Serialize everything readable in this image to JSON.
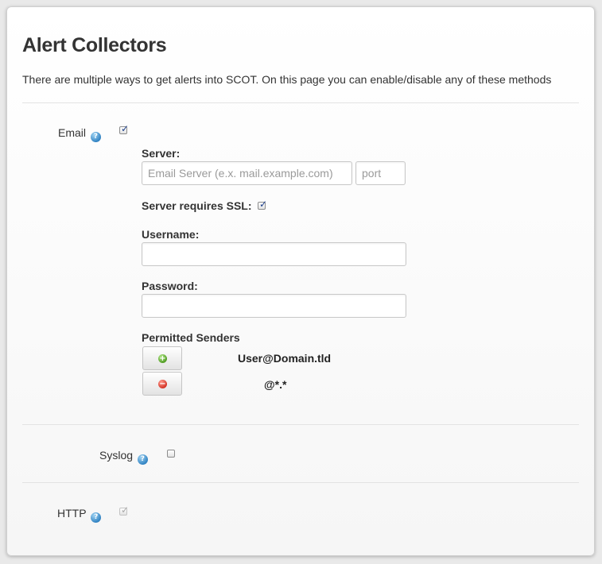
{
  "page": {
    "title": "Alert Collectors",
    "description": "There are multiple ways to get alerts into SCOT. On this page you can enable/disable any of these methods"
  },
  "email": {
    "label": "Email",
    "enabled": true,
    "server_label": "Server:",
    "server_placeholder": "Email Server (e.x. mail.example.com)",
    "server_value": "",
    "port_placeholder": "port",
    "port_value": "",
    "ssl_label": "Server requires SSL:",
    "ssl_enabled": true,
    "username_label": "Username:",
    "username_value": "",
    "password_label": "Password:",
    "password_value": "",
    "permitted_senders_label": "Permitted Senders",
    "senders": [
      "User@Domain.tld",
      "@*.*"
    ]
  },
  "syslog": {
    "label": "Syslog",
    "enabled": false
  },
  "http": {
    "label": "HTTP",
    "enabled": true,
    "disabled": true
  },
  "icons": {
    "help": "question-circle-icon",
    "add": "plus-circle-icon",
    "remove": "minus-circle-icon"
  },
  "colors": {
    "help_icon": "#2c7fc0",
    "add_icon": "#4d9a1f",
    "remove_icon": "#d22f22",
    "checkbox_tick": "#1c3f8a"
  }
}
